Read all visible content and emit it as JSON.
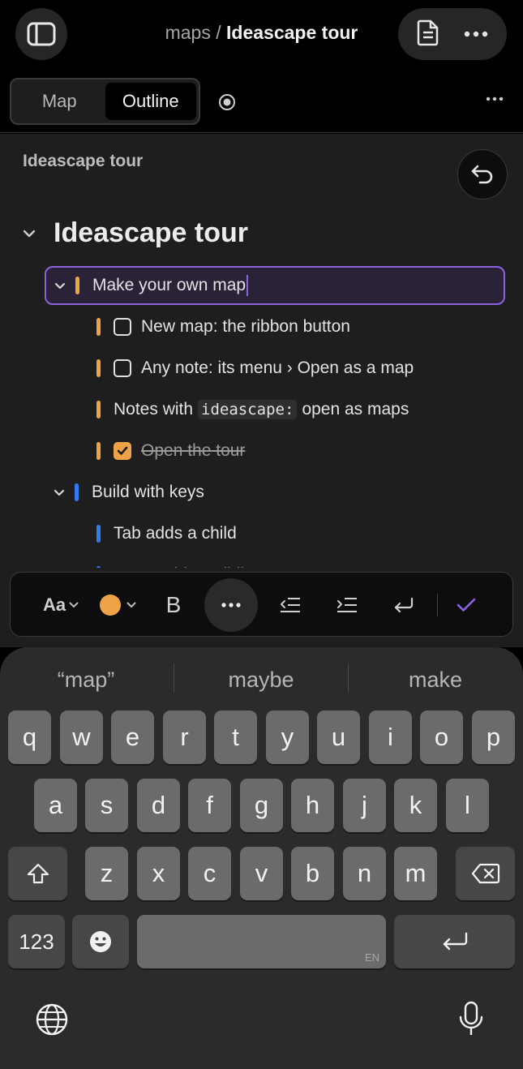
{
  "header": {
    "breadcrumb_parent": "maps",
    "breadcrumb_sep": "/",
    "breadcrumb_current": "Ideascape tour"
  },
  "tabs": [
    {
      "label": "Map",
      "active": false
    },
    {
      "label": "Outline",
      "active": true
    }
  ],
  "doc": {
    "small_title": "Ideascape tour",
    "heading": "Ideascape tour"
  },
  "outline": {
    "editing_item": "Make your own map",
    "items": [
      {
        "text": "New map: the ribbon button",
        "checkbox": true,
        "checked": false,
        "color": "#f0a346"
      },
      {
        "text": "Any note: its menu › Open as a map",
        "checkbox": true,
        "checked": false,
        "color": "#f0a346"
      },
      {
        "text_before": "Notes with",
        "code": "ideascape:",
        "text_after": "open as maps",
        "color": "#f0a346"
      },
      {
        "text": "Open the tour",
        "checkbox": true,
        "checked": true,
        "color": "#f0a346"
      }
    ],
    "section2": "Build with keys",
    "section2_child": "Tab adds a child",
    "section2_partial": "Enter adds a sibling"
  },
  "format_toolbar": {
    "text_style_label": "Aa",
    "bold_label": "B",
    "color": "#f0a346"
  },
  "keyboard": {
    "suggestions": [
      "“map”",
      "maybe",
      "make"
    ],
    "row1": [
      "q",
      "w",
      "e",
      "r",
      "t",
      "y",
      "u",
      "i",
      "o",
      "p"
    ],
    "row2": [
      "a",
      "s",
      "d",
      "f",
      "g",
      "h",
      "j",
      "k",
      "l"
    ],
    "row3": [
      "z",
      "x",
      "c",
      "v",
      "b",
      "n",
      "m"
    ],
    "numbers_label": "123",
    "space_lang": "EN"
  },
  "colors": {
    "accent_purple": "#8b62e0",
    "orange": "#f0a346",
    "blue": "#2f7cf6"
  }
}
